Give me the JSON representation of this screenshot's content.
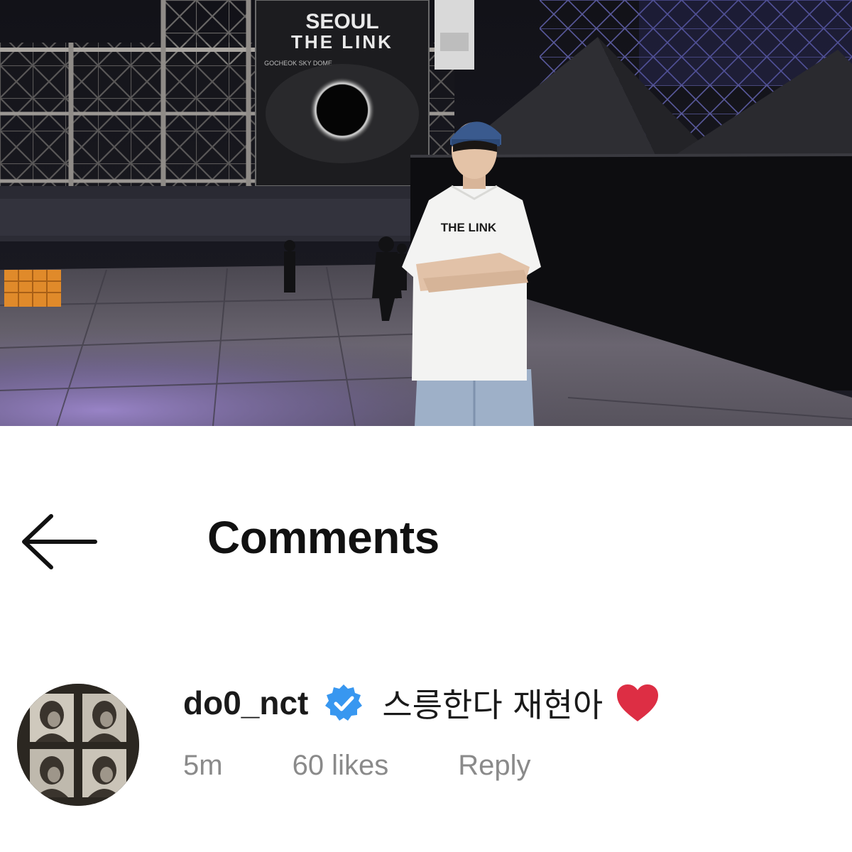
{
  "photo": {
    "banner_text_line1": "SEOUL",
    "banner_text_line2": "THE LINK",
    "banner_subtext": "GOCHEOK SKY DOME",
    "shirt_text": "THE LINK"
  },
  "header": {
    "title": "Comments",
    "back_icon": "arrow-left-icon"
  },
  "comment": {
    "username": "do0_nct",
    "verified_icon": "verified-badge-icon",
    "text": "스릉한다 재현아",
    "heart_icon": "red-heart-emoji",
    "time": "5m",
    "likes": "60 likes",
    "reply_label": "Reply"
  },
  "colors": {
    "text_primary": "#111111",
    "text_secondary": "#8a8a8a",
    "verified_blue": "#3897f0",
    "heart_red": "#dd2e44",
    "background": "#ffffff"
  }
}
